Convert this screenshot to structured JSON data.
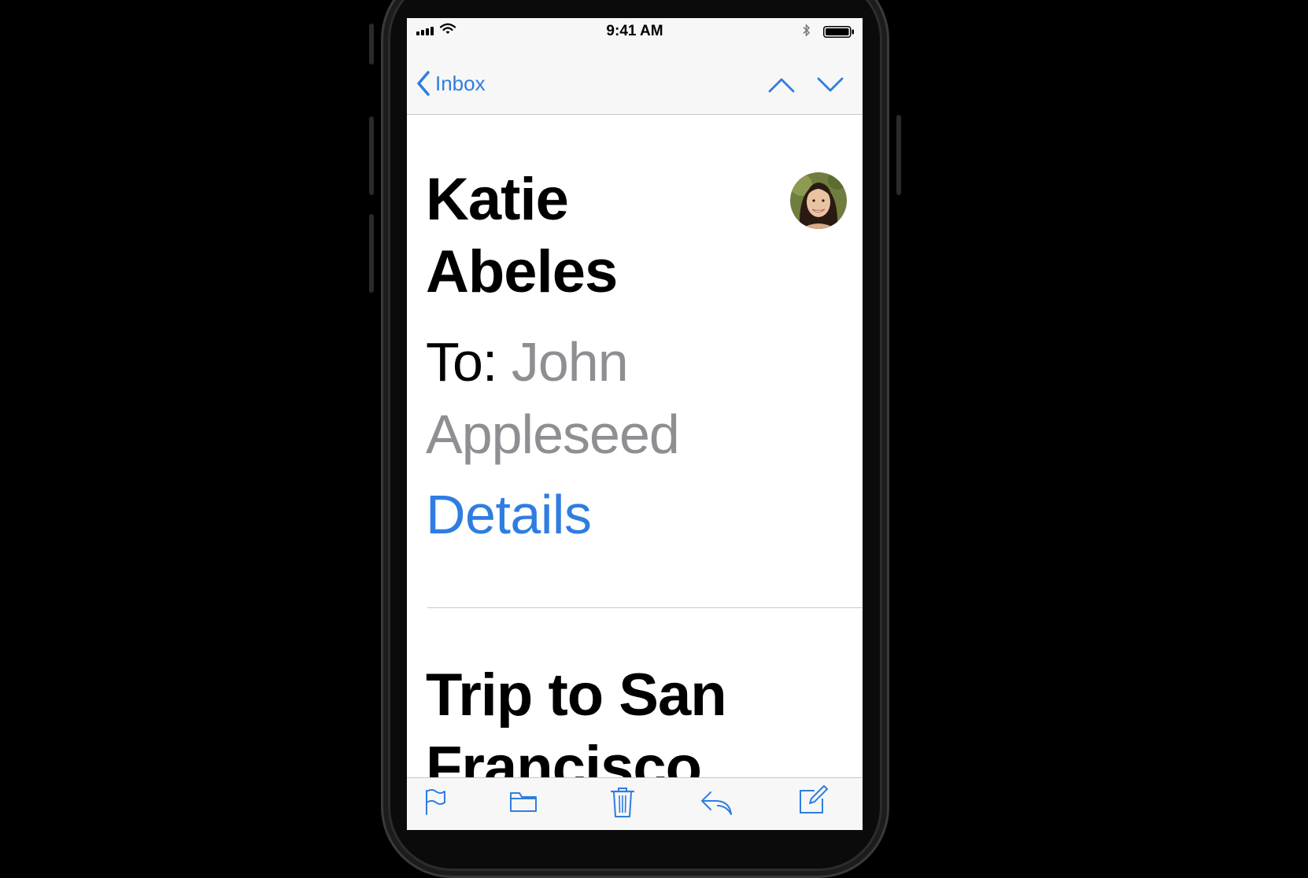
{
  "status_bar": {
    "time": "9:41 AM"
  },
  "nav": {
    "back_label": "Inbox"
  },
  "message": {
    "sender_name": "Katie Abeles",
    "to_label": "To:",
    "recipient": "John Appleseed",
    "details_label": "Details",
    "subject": "Trip to San Francisco"
  },
  "toolbar": {
    "icons": [
      "flag-icon",
      "folder-icon",
      "trash-icon",
      "reply-icon",
      "compose-icon"
    ]
  },
  "colors": {
    "accent": "#2f7de1",
    "secondary_text": "#8e8e93",
    "bar_background": "#f7f7f7"
  }
}
